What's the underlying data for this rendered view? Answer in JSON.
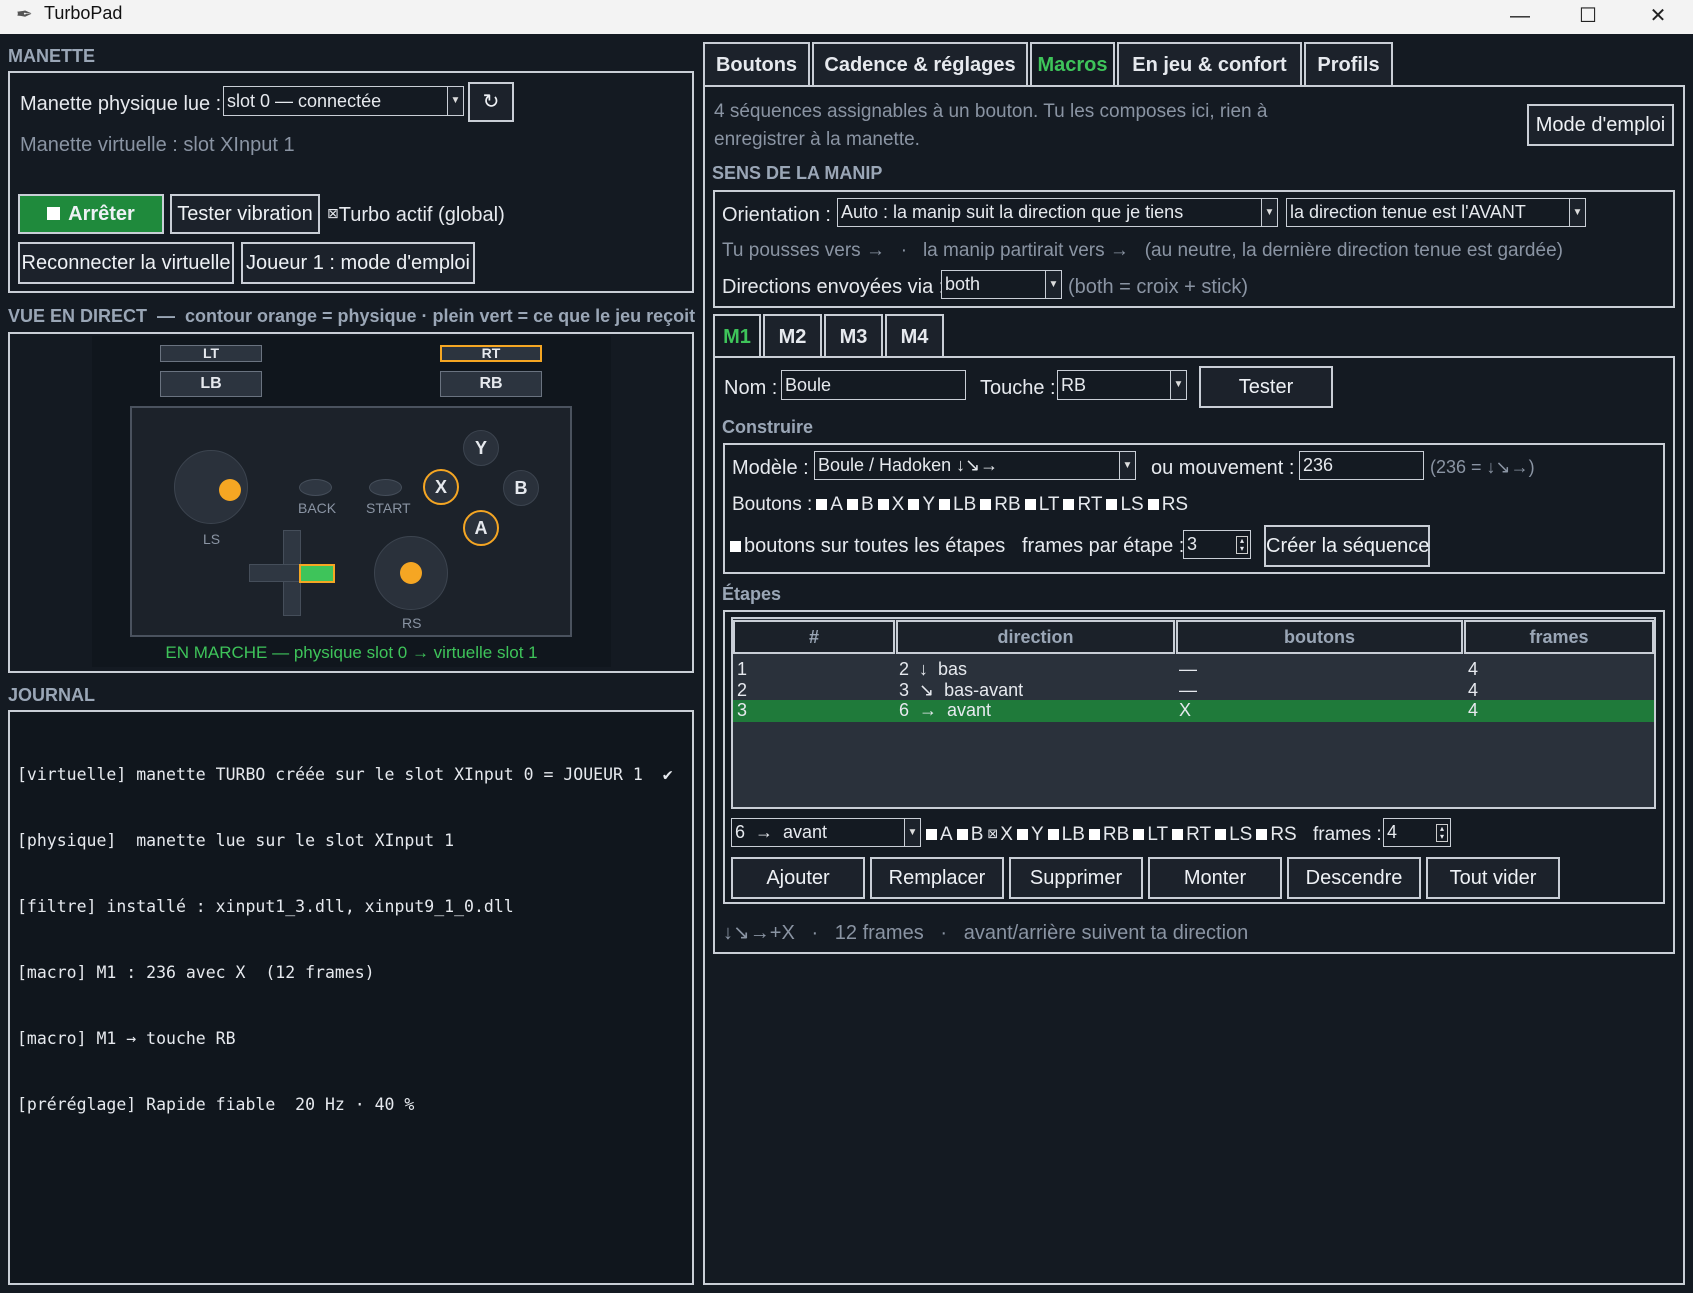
{
  "window": {
    "title": "TurboPad"
  },
  "manette": {
    "section": "MANETTE",
    "phys_label": "Manette physique lue :",
    "phys_value": "slot 0 — connectée",
    "virtual_label": "Manette virtuelle : slot XInput 1",
    "stop_label": "Arrêter",
    "vibration_label": "Tester vibration",
    "turbo_label": "Turbo actif (global)",
    "reconnect_label": "Reconnecter la virtuelle",
    "player_label": "Joueur 1 : mode d'emploi"
  },
  "live": {
    "section": "VUE EN DIRECT  —  contour orange = physique · plein vert = ce que le jeu reçoit",
    "lt": "LT",
    "rt": "RT",
    "lb": "LB",
    "rb": "RB",
    "back": "BACK",
    "start": "START",
    "ls": "LS",
    "rs": "RS",
    "y": "Y",
    "x": "X",
    "b": "B",
    "a": "A",
    "status": "EN MARCHE — physique slot 0 → virtuelle slot 1"
  },
  "journal": {
    "section": "JOURNAL",
    "lines": [
      "[virtuelle] manette TURBO créée sur le slot XInput 0 = JOUEUR 1",
      "[physique]  manette lue sur le slot XInput 1",
      "[filtre] installé : xinput1_3.dll, xinput9_1_0.dll",
      "[macro] M1 : 236 avec X  (12 frames)",
      "[macro] M1 → touche RB",
      "[préréglage] Rapide fiable  20 Hz · 40 %"
    ]
  },
  "tabs": [
    "Boutons",
    "Cadence & réglages",
    "Macros",
    "En jeu & confort",
    "Profils"
  ],
  "macros": {
    "intro_1": "4 séquences assignables à un bouton. Tu les composes ici, rien à",
    "intro_2": "enregistrer à la manette.",
    "help_label": "Mode d'emploi",
    "sens_section": "SENS DE LA MANIP",
    "orientation_label": "Orientation :",
    "orientation_value": "Auto : la manip suit la direction que je tiens",
    "orientation_value2": "la direction tenue est l'AVANT",
    "push_text": "Tu pousses vers →   ·   la manip partirait vers →   (au neutre, la dernière direction tenue est gardée)",
    "sent_label": "Directions envoyées via :",
    "sent_value": "both",
    "sent_hint": "(both = croix + stick)",
    "subtabs": [
      "M1",
      "M2",
      "M3",
      "M4"
    ],
    "name_label": "Nom :",
    "name_value": "Boule",
    "key_label": "Touche :",
    "key_value": "RB",
    "test_label": "Tester",
    "build_section": "Construire",
    "model_label": "Modèle :",
    "model_value": "Boule / Hadoken  ↓↘→",
    "move_label": "ou mouvement :",
    "move_value": "236",
    "move_hint": "(236 = ↓↘→)",
    "buttons_label": "Boutons :",
    "button_names": [
      "A",
      "B",
      "X",
      "Y",
      "LB",
      "RB",
      "LT",
      "RT",
      "LS",
      "RS"
    ],
    "all_steps_label": "boutons sur toutes les étapes",
    "frames_step_label": "frames par étape :",
    "frames_step_value": "3",
    "create_label": "Créer la séquence",
    "steps_section": "Étapes",
    "columns": [
      "#",
      "direction",
      "boutons",
      "frames"
    ],
    "rows": [
      {
        "n": "1",
        "dir": "2  ↓  bas",
        "btn": "—",
        "frames": "4"
      },
      {
        "n": "2",
        "dir": "3  ↘  bas-avant",
        "btn": "—",
        "frames": "4"
      },
      {
        "n": "3",
        "dir": "6  →  avant",
        "btn": "X",
        "frames": "4"
      }
    ],
    "edit_dir_value": "6  →  avant",
    "edit_buttons": [
      "A",
      "B",
      "X",
      "Y",
      "LB",
      "RB",
      "LT",
      "RT",
      "LS",
      "RS"
    ],
    "edit_frames_label": "frames :",
    "edit_frames_value": "4",
    "actions": [
      "Ajouter",
      "Remplacer",
      "Supprimer",
      "Monter",
      "Descendre",
      "Tout vider"
    ],
    "summary": "↓↘→+X   ·   12 frames   ·   avant/arrière suivent ta direction"
  },
  "colors": {
    "accent_green": "#3ec45a",
    "orange": "#f5a623",
    "selected_row": "#1f7a3a",
    "stop_btn": "#1f8a3c"
  }
}
